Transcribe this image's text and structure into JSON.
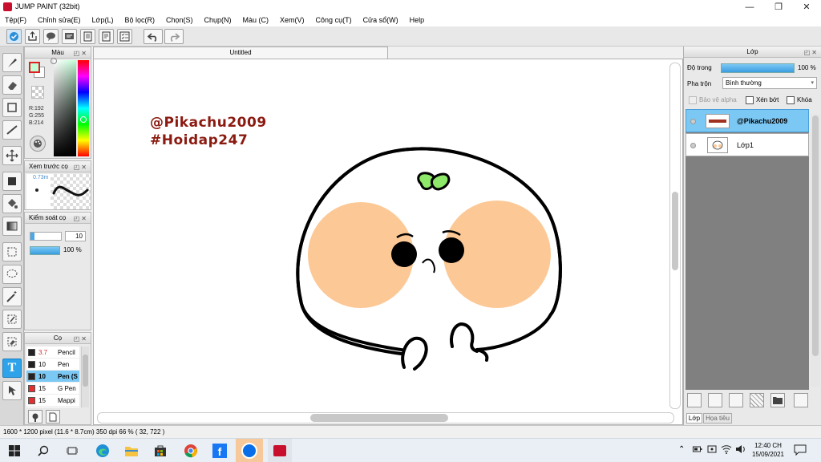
{
  "window": {
    "title": "JUMP PAINT (32bit)",
    "minimize": "—",
    "maximize": "❐",
    "close": "✕"
  },
  "menu": [
    "Tệp(F)",
    "Chỉnh sửa(E)",
    "Lớp(L)",
    "Bộ lọc(R)",
    "Chọn(S)",
    "Chụp(N)",
    "Màu (C)",
    "Xem(V)",
    "Công cụ(T)",
    "Cửa sổ(W)",
    "Help"
  ],
  "toolbar_icons": [
    "dropbox-sync-icon",
    "share-icon",
    "speech-bubble-icon",
    "comment-icon",
    "page-icon",
    "document-icon",
    "checklist-icon",
    "undo-icon",
    "redo-icon"
  ],
  "color_panel": {
    "title": "Màu",
    "r": "R:192",
    "g": "G:255",
    "b": "B:214",
    "foreground": "#c0ffd6",
    "background": "#ffffff"
  },
  "brush_preview_panel": {
    "title": "Xem trước cọ",
    "size_label": "0.73m"
  },
  "brush_control_panel": {
    "title": "Kiểm soát cọ",
    "size_value": "10",
    "opacity_value": "100 %"
  },
  "brush_panel": {
    "title": "Cọ",
    "items": [
      {
        "size": "3.7",
        "name": "Pencil",
        "color": "#222222",
        "size_color": "#d03030",
        "selected": false
      },
      {
        "size": "10",
        "name": "Pen",
        "color": "#222222",
        "size_color": "#000000",
        "selected": false
      },
      {
        "size": "10",
        "name": "Pen (S",
        "color": "#222222",
        "size_color": "#000000",
        "selected": true
      },
      {
        "size": "15",
        "name": "G Pen",
        "color": "#e03030",
        "size_color": "#000000",
        "selected": false
      },
      {
        "size": "15",
        "name": "Mappi",
        "color": "#e03030",
        "size_color": "#000000",
        "selected": false
      }
    ]
  },
  "document": {
    "tab_title": "Untitled",
    "watermark_line1": "@Pikachu2009",
    "watermark_line2": "#Hoidap247",
    "watermark_color": "#8b1a10",
    "cheek_color": "#fcc896",
    "sprout_color": "#8ee86a"
  },
  "layer_panel": {
    "title": "Lớp",
    "opacity_label": "Độ trong",
    "opacity_value": "100 %",
    "blend_label": "Pha trộn",
    "blend_value": "Bình thường",
    "protect_alpha": "Bảo vệ alpha",
    "clip": "Xén bớt",
    "lock": "Khóa",
    "layers": [
      {
        "name": "@Pikachu2009",
        "selected": true
      },
      {
        "name": "Lớp1",
        "selected": false
      }
    ],
    "tab_layer": "Lớp",
    "tab_material": "Họa tiêu"
  },
  "status": {
    "text": "1600 * 1200 pixel   (11.6 * 8.7cm)   350 dpi   66 %   ( 32, 722 )"
  },
  "taskbar": {
    "time": "12:40 CH",
    "date": "15/09/2021"
  }
}
